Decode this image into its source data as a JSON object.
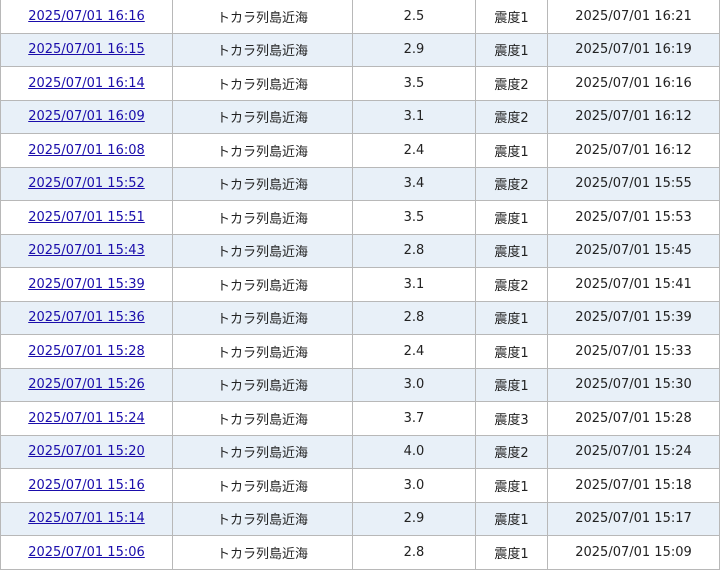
{
  "rows": [
    {
      "time": "2025/07/01 16:16",
      "area": "トカラ列島近海",
      "magnitude": "2.5",
      "intensity": "震度1",
      "announced": "2025/07/01 16:21"
    },
    {
      "time": "2025/07/01 16:15",
      "area": "トカラ列島近海",
      "magnitude": "2.9",
      "intensity": "震度1",
      "announced": "2025/07/01 16:19"
    },
    {
      "time": "2025/07/01 16:14",
      "area": "トカラ列島近海",
      "magnitude": "3.5",
      "intensity": "震度2",
      "announced": "2025/07/01 16:16"
    },
    {
      "time": "2025/07/01 16:09",
      "area": "トカラ列島近海",
      "magnitude": "3.1",
      "intensity": "震度2",
      "announced": "2025/07/01 16:12"
    },
    {
      "time": "2025/07/01 16:08",
      "area": "トカラ列島近海",
      "magnitude": "2.4",
      "intensity": "震度1",
      "announced": "2025/07/01 16:12"
    },
    {
      "time": "2025/07/01 15:52",
      "area": "トカラ列島近海",
      "magnitude": "3.4",
      "intensity": "震度2",
      "announced": "2025/07/01 15:55"
    },
    {
      "time": "2025/07/01 15:51",
      "area": "トカラ列島近海",
      "magnitude": "3.5",
      "intensity": "震度1",
      "announced": "2025/07/01 15:53"
    },
    {
      "time": "2025/07/01 15:43",
      "area": "トカラ列島近海",
      "magnitude": "2.8",
      "intensity": "震度1",
      "announced": "2025/07/01 15:45"
    },
    {
      "time": "2025/07/01 15:39",
      "area": "トカラ列島近海",
      "magnitude": "3.1",
      "intensity": "震度2",
      "announced": "2025/07/01 15:41"
    },
    {
      "time": "2025/07/01 15:36",
      "area": "トカラ列島近海",
      "magnitude": "2.8",
      "intensity": "震度1",
      "announced": "2025/07/01 15:39"
    },
    {
      "time": "2025/07/01 15:28",
      "area": "トカラ列島近海",
      "magnitude": "2.4",
      "intensity": "震度1",
      "announced": "2025/07/01 15:33"
    },
    {
      "time": "2025/07/01 15:26",
      "area": "トカラ列島近海",
      "magnitude": "3.0",
      "intensity": "震度1",
      "announced": "2025/07/01 15:30"
    },
    {
      "time": "2025/07/01 15:24",
      "area": "トカラ列島近海",
      "magnitude": "3.7",
      "intensity": "震度3",
      "announced": "2025/07/01 15:28"
    },
    {
      "time": "2025/07/01 15:20",
      "area": "トカラ列島近海",
      "magnitude": "4.0",
      "intensity": "震度2",
      "announced": "2025/07/01 15:24"
    },
    {
      "time": "2025/07/01 15:16",
      "area": "トカラ列島近海",
      "magnitude": "3.0",
      "intensity": "震度1",
      "announced": "2025/07/01 15:18"
    },
    {
      "time": "2025/07/01 15:14",
      "area": "トカラ列島近海",
      "magnitude": "2.9",
      "intensity": "震度1",
      "announced": "2025/07/01 15:17"
    },
    {
      "time": "2025/07/01 15:06",
      "area": "トカラ列島近海",
      "magnitude": "2.8",
      "intensity": "震度1",
      "announced": "2025/07/01 15:09"
    }
  ],
  "colors": {
    "link": "#1a0dab",
    "row_alt": "#e8f0f8",
    "border": "#b8b8b8"
  }
}
